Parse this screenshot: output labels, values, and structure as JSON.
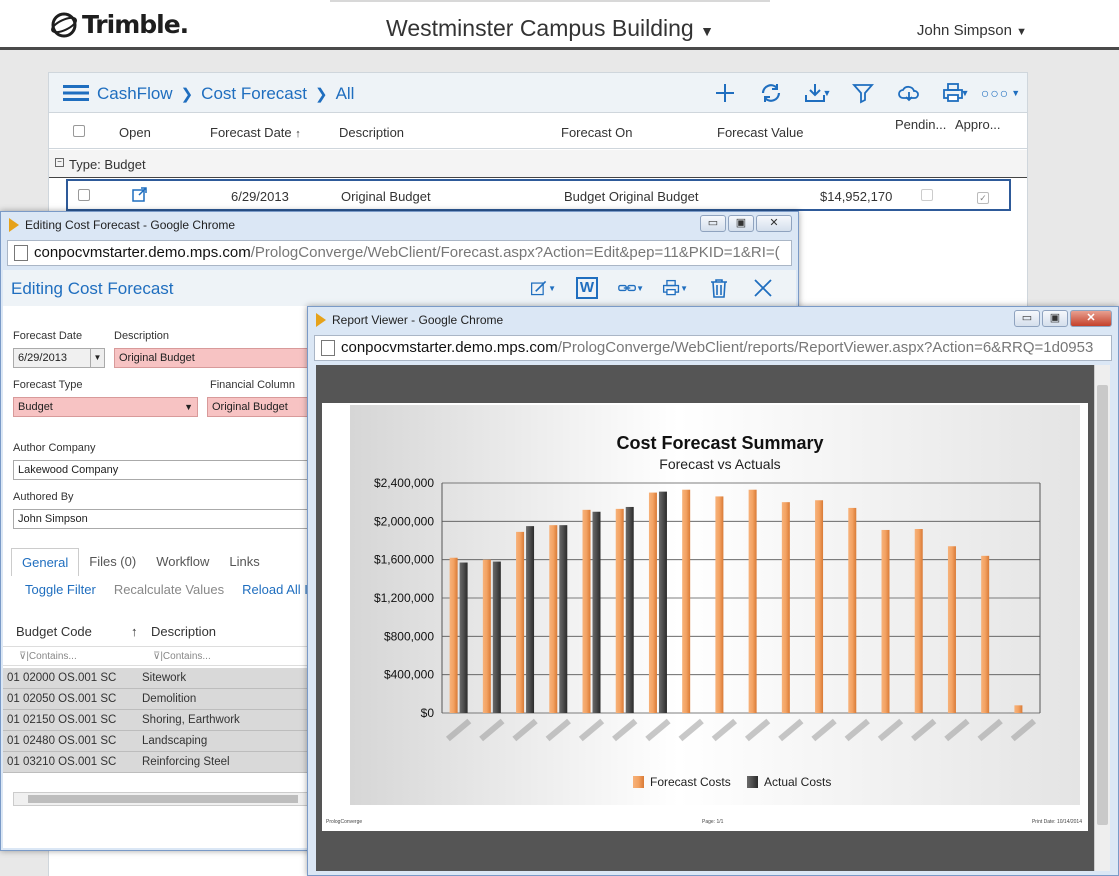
{
  "header": {
    "logo_text": "Trimble.",
    "project": "Westminster Campus Building",
    "user": "John Simpson"
  },
  "main": {
    "breadcrumb": [
      "CashFlow",
      "Cost Forecast",
      "All"
    ],
    "toolbar_icons": [
      "plus-icon",
      "refresh-icon",
      "download-icon",
      "filter-icon",
      "cloud-icon",
      "print-icon",
      "more-icon"
    ],
    "columns": {
      "open": "Open",
      "forecast_date": "Forecast Date",
      "description": "Description",
      "forecast_on": "Forecast On",
      "forecast_value": "Forecast Value",
      "pending": "Pendin...",
      "approved": "Appro..."
    },
    "sort_indicator": "↑",
    "group_label": "Type: Budget",
    "row": {
      "date": "6/29/2013",
      "description": "Original Budget",
      "forecast_on": "Budget Original Budget",
      "value": "$14,952,170"
    }
  },
  "edit_window": {
    "title": "Editing Cost Forecast - Google Chrome",
    "url_host": "conpocvmstarter.demo.mps.com",
    "url_path": "/PrologConverge/WebClient/Forecast.aspx?Action=Edit&pep=11&PKID=1&RI=(",
    "heading": "Editing Cost Forecast",
    "fields": {
      "forecast_date_label": "Forecast Date",
      "forecast_date": "6/29/2013",
      "description_label": "Description",
      "description": "Original Budget",
      "forecast_type_label": "Forecast Type",
      "forecast_type": "Budget",
      "financial_column_label": "Financial Column",
      "financial_column": "Original Budget",
      "author_company_label": "Author Company",
      "author_company": "Lakewood Company",
      "authored_by_label": "Authored By",
      "authored_by": "John Simpson"
    },
    "tabs": [
      "General",
      "Files (0)",
      "Workflow",
      "Links"
    ],
    "actions": {
      "toggle_filter": "Toggle Filter",
      "recalculate": "Recalculate Values",
      "reload": "Reload All I"
    },
    "budget_headers": {
      "code": "Budget Code",
      "sort": "↑",
      "description": "Description"
    },
    "filter_placeholder": "Contains...",
    "budget_rows": [
      {
        "code": "01 02000 OS.001 SC",
        "description": "Sitework"
      },
      {
        "code": "01 02050 OS.001 SC",
        "description": "Demolition"
      },
      {
        "code": "01 02150 OS.001 SC",
        "description": "Shoring, Earthwork"
      },
      {
        "code": "01 02480 OS.001 SC",
        "description": "Landscaping"
      },
      {
        "code": "01 03210 OS.001 SC",
        "description": "Reinforcing Steel"
      }
    ]
  },
  "report_window": {
    "title": "Report Viewer - Google Chrome",
    "url_host": "conpocvmstarter.demo.mps.com",
    "url_path": "/PrologConverge/WebClient/reports/ReportViewer.aspx?Action=6&RRQ=1d0953",
    "footer_left": "PrologConverge",
    "footer_mid": "Page: 1/1",
    "footer_right": "Print Date: 10/14/2014"
  },
  "colors": {
    "forecast": "#f3a262",
    "actual": "#4d4d4d",
    "accent": "#1f6ebf"
  },
  "chart_data": {
    "type": "bar",
    "title": "Cost Forecast Summary",
    "subtitle": "Forecast vs Actuals",
    "ylim": [
      0,
      2400000
    ],
    "y_ticks": [
      "$0",
      "$400,000",
      "$800,000",
      "$1,200,000",
      "$1,600,000",
      "$2,000,000",
      "$2,400,000"
    ],
    "legend_position": "bottom",
    "series": [
      {
        "name": "Forecast Costs",
        "values": [
          1620000,
          1600000,
          1890000,
          1960000,
          2120000,
          2130000,
          2300000,
          2330000,
          2260000,
          2330000,
          2200000,
          2220000,
          2140000,
          1910000,
          1920000,
          1740000,
          1640000,
          80000
        ]
      },
      {
        "name": "Actual Costs",
        "values": [
          1570000,
          1580000,
          1950000,
          1960000,
          2100000,
          2150000,
          2310000,
          null,
          null,
          null,
          null,
          null,
          null,
          null,
          null,
          null,
          null,
          null
        ]
      }
    ]
  }
}
